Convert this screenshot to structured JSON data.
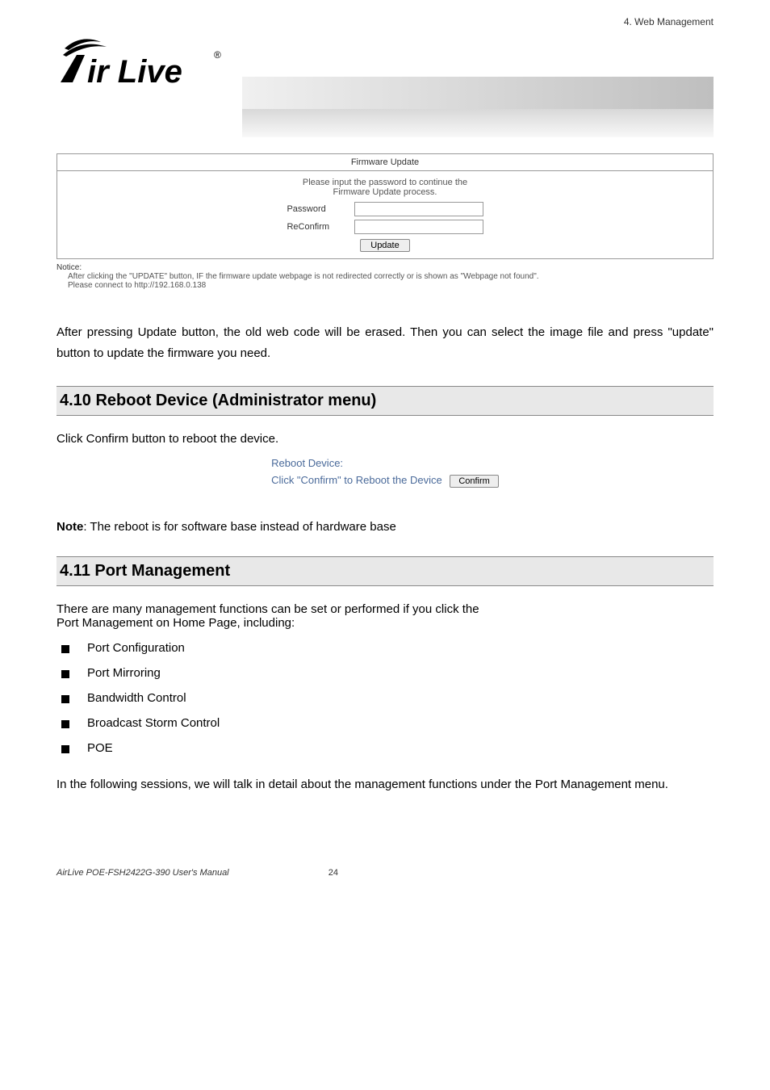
{
  "header": {
    "breadcrumb": "4. Web Management",
    "logo_main": "ir Live",
    "logo_reg": "®"
  },
  "firmware": {
    "title": "Firmware Update",
    "instruction1": "Please input the password to continue the",
    "instruction2": "Firmware Update process.",
    "password_label": "Password",
    "reconfirm_label": "ReConfirm",
    "update_btn": "Update"
  },
  "notice": {
    "title": "Notice:",
    "line1": "After clicking the \"UPDATE\" button, IF the firmware update webpage is not redirected correctly or is shown as \"Webpage not found\".",
    "line2": "Please connect to http://192.168.0.138"
  },
  "para1": "After pressing Update button, the old web code will be erased. Then you can select the image file and press \"update\" button to update the firmware you need.",
  "section_reboot": {
    "heading": "4.10 Reboot Device (Administrator menu)",
    "intro": "Click Confirm button to reboot the device.",
    "box_line1": "Reboot Device:",
    "box_line2": "Click \"Confirm\" to Reboot the Device",
    "confirm_btn": "Confirm"
  },
  "note_line_bold": "Note",
  "note_line_rest": ": The reboot is for software base instead of hardware base",
  "section_port": {
    "heading": "4.11 Port Management",
    "intro1": "There are many management functions can be set or performed if you click the",
    "intro2": "Port Management on Home Page, including:",
    "items": [
      "Port Configuration",
      "Port Mirroring",
      "Bandwidth Control",
      "Broadcast Storm Control",
      "POE"
    ],
    "outro": "In the following sessions, we will talk in detail about the management functions under the Port Management menu."
  },
  "footer": {
    "manual": "AirLive POE-FSH2422G-390 User's Manual",
    "page": "24"
  }
}
